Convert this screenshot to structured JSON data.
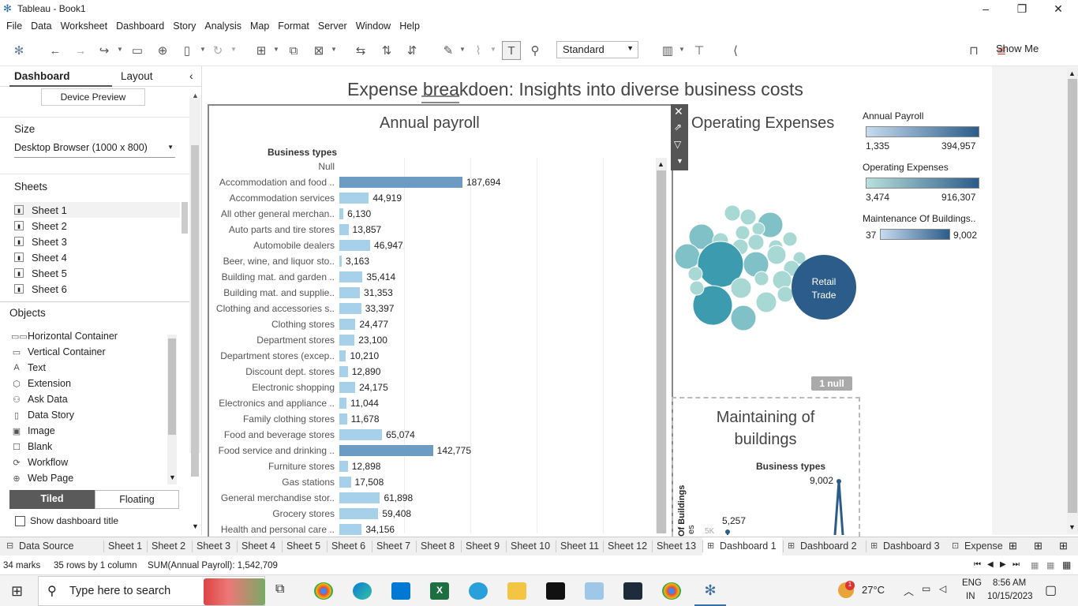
{
  "window": {
    "title": "Tableau - Book1"
  },
  "menu": [
    "File",
    "Data",
    "Worksheet",
    "Dashboard",
    "Story",
    "Analysis",
    "Map",
    "Format",
    "Server",
    "Window",
    "Help"
  ],
  "toolbar": {
    "fit_dropdown": "Standard",
    "show_me": "Show Me"
  },
  "left_pane": {
    "tabs": [
      "Dashboard",
      "Layout"
    ],
    "device_preview": "Device Preview",
    "size_title": "Size",
    "size_value": "Desktop Browser (1000 x 800)",
    "sheets_title": "Sheets",
    "sheets": [
      "Sheet 1",
      "Sheet 2",
      "Sheet 3",
      "Sheet 4",
      "Sheet 5",
      "Sheet 6"
    ],
    "objects_title": "Objects",
    "objects": [
      {
        "label": "Horizontal Container",
        "icon": "horizontal-container-icon"
      },
      {
        "label": "Vertical Container",
        "icon": "vertical-container-icon"
      },
      {
        "label": "Text",
        "icon": "text-icon"
      },
      {
        "label": "Extension",
        "icon": "extension-icon"
      },
      {
        "label": "Ask Data",
        "icon": "ask-data-icon"
      },
      {
        "label": "Data Story",
        "icon": "data-story-icon"
      },
      {
        "label": "Image",
        "icon": "image-icon"
      },
      {
        "label": "Blank",
        "icon": "blank-icon"
      },
      {
        "label": "Workflow",
        "icon": "workflow-icon"
      },
      {
        "label": "Web Page",
        "icon": "web-page-icon"
      }
    ],
    "tiled": "Tiled",
    "floating": "Floating",
    "show_title": "Show dashboard title"
  },
  "dashboard": {
    "title": "Expense breakdoen: Insights into diverse business costs",
    "payroll_title": "Annual payroll",
    "opex_title": "Operating Expenses",
    "maint_title": "Maintaining of buildings",
    "business_types": "Business types",
    "null_badge": "1 null",
    "bubble_label": "Retail Trade",
    "maint_values": [
      "9,002",
      "5,257"
    ],
    "maint_axis_fragment": "Of Buildings",
    "maint_axis_fragment2": "es",
    "maint_tick_fragment": "5K"
  },
  "legends": [
    {
      "title": "Annual Payroll",
      "min": "1,335",
      "max": "394,957",
      "color_from": "#c6dbef",
      "color_to": "#2b5c8a"
    },
    {
      "title": "Operating Expenses",
      "min": "3,474",
      "max": "916,307",
      "color_from": "#b8e0dc",
      "color_to": "#2b5c8a"
    },
    {
      "title": "Maintenance Of Buildings..",
      "min": "37",
      "max": "9,002",
      "color_from": "#c6dbef",
      "color_to": "#2b5c8a"
    }
  ],
  "chart_data": {
    "type": "bar",
    "title": "Annual payroll",
    "ylabel": "Business types",
    "categories": [
      "Null",
      "Accommodation and food ..",
      "Accommodation services",
      "All other general merchan..",
      "Auto parts and tire stores",
      "Automobile dealers",
      "Beer, wine, and liquor sto..",
      "Building mat. and garden ..",
      "Building mat. and supplie..",
      "Clothing and accessories s..",
      "Clothing stores",
      "Department stores",
      "Department stores (excep..",
      "Discount dept. stores",
      "Electronic shopping",
      "Electronics and appliance ..",
      "Family clothing stores",
      "Food and beverage stores",
      "Food service and drinking ..",
      "Furniture stores",
      "Gas stations",
      "General merchandise stor..",
      "Grocery stores",
      "Health and personal care .."
    ],
    "values": [
      null,
      187694,
      44919,
      6130,
      13857,
      46947,
      3163,
      35414,
      31353,
      33397,
      24477,
      23100,
      10210,
      12890,
      24175,
      11044,
      11678,
      65074,
      142775,
      12898,
      17508,
      61898,
      59408,
      34156
    ],
    "value_labels": [
      "",
      "187,694",
      "44,919",
      "6,130",
      "13,857",
      "46,947",
      "3,163",
      "35,414",
      "31,353",
      "33,397",
      "24,477",
      "23,100",
      "10,210",
      "12,890",
      "24,175",
      "11,044",
      "11,678",
      "65,074",
      "142,775",
      "12,898",
      "17,508",
      "61,898",
      "59,408",
      "34,156"
    ],
    "xlim": [
      0,
      500000
    ]
  },
  "sheet_tabs": [
    "Data Source",
    "Sheet 1",
    "Sheet 2",
    "Sheet 3",
    "Sheet 4",
    "Sheet 5",
    "Sheet 6",
    "Sheet 7",
    "Sheet 8",
    "Sheet 9",
    "Sheet 10",
    "Sheet 11",
    "Sheet 12",
    "Sheet 13",
    "Dashboard 1",
    "Dashboard 2",
    "Dashboard 3",
    "Expense"
  ],
  "status": {
    "marks": "34 marks",
    "rows": "35 rows by 1 column",
    "sum": "SUM(Annual Payroll): 1,542,709"
  },
  "taskbar": {
    "search_placeholder": "Type here to search",
    "temp": "27°C",
    "lang": "ENG",
    "region": "IN",
    "time": "8:56 AM",
    "date": "10/15/2023",
    "notification_count": "1"
  }
}
